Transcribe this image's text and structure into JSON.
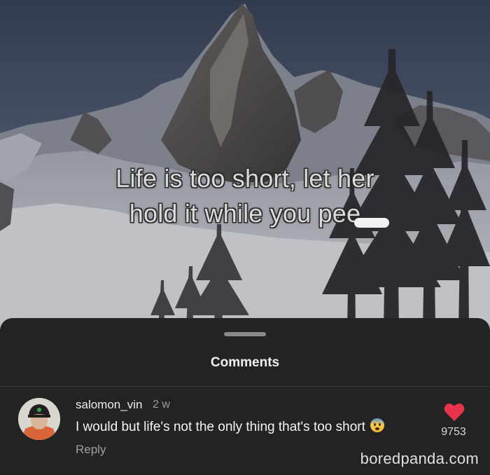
{
  "caption": {
    "line1": "Life is too short, let her",
    "line2": "hold it while you pee"
  },
  "sheet": {
    "title": "Comments"
  },
  "comment": {
    "username": "salomon_vin",
    "time": "2 w",
    "text": "I would but life's not the only thing that's too short",
    "emoji": "anxious-face-with-sweat",
    "reply_label": "Reply",
    "like_count": "9753"
  },
  "watermark": "boredpanda.com",
  "colors": {
    "sheet_background": "#232323",
    "like_heart": "#e8344a",
    "username": "#ededed",
    "secondary_text": "#9a9a9a"
  },
  "icons": {
    "like": "heart-icon",
    "emoji": "anxious-face-icon",
    "handle": "drag-handle"
  }
}
